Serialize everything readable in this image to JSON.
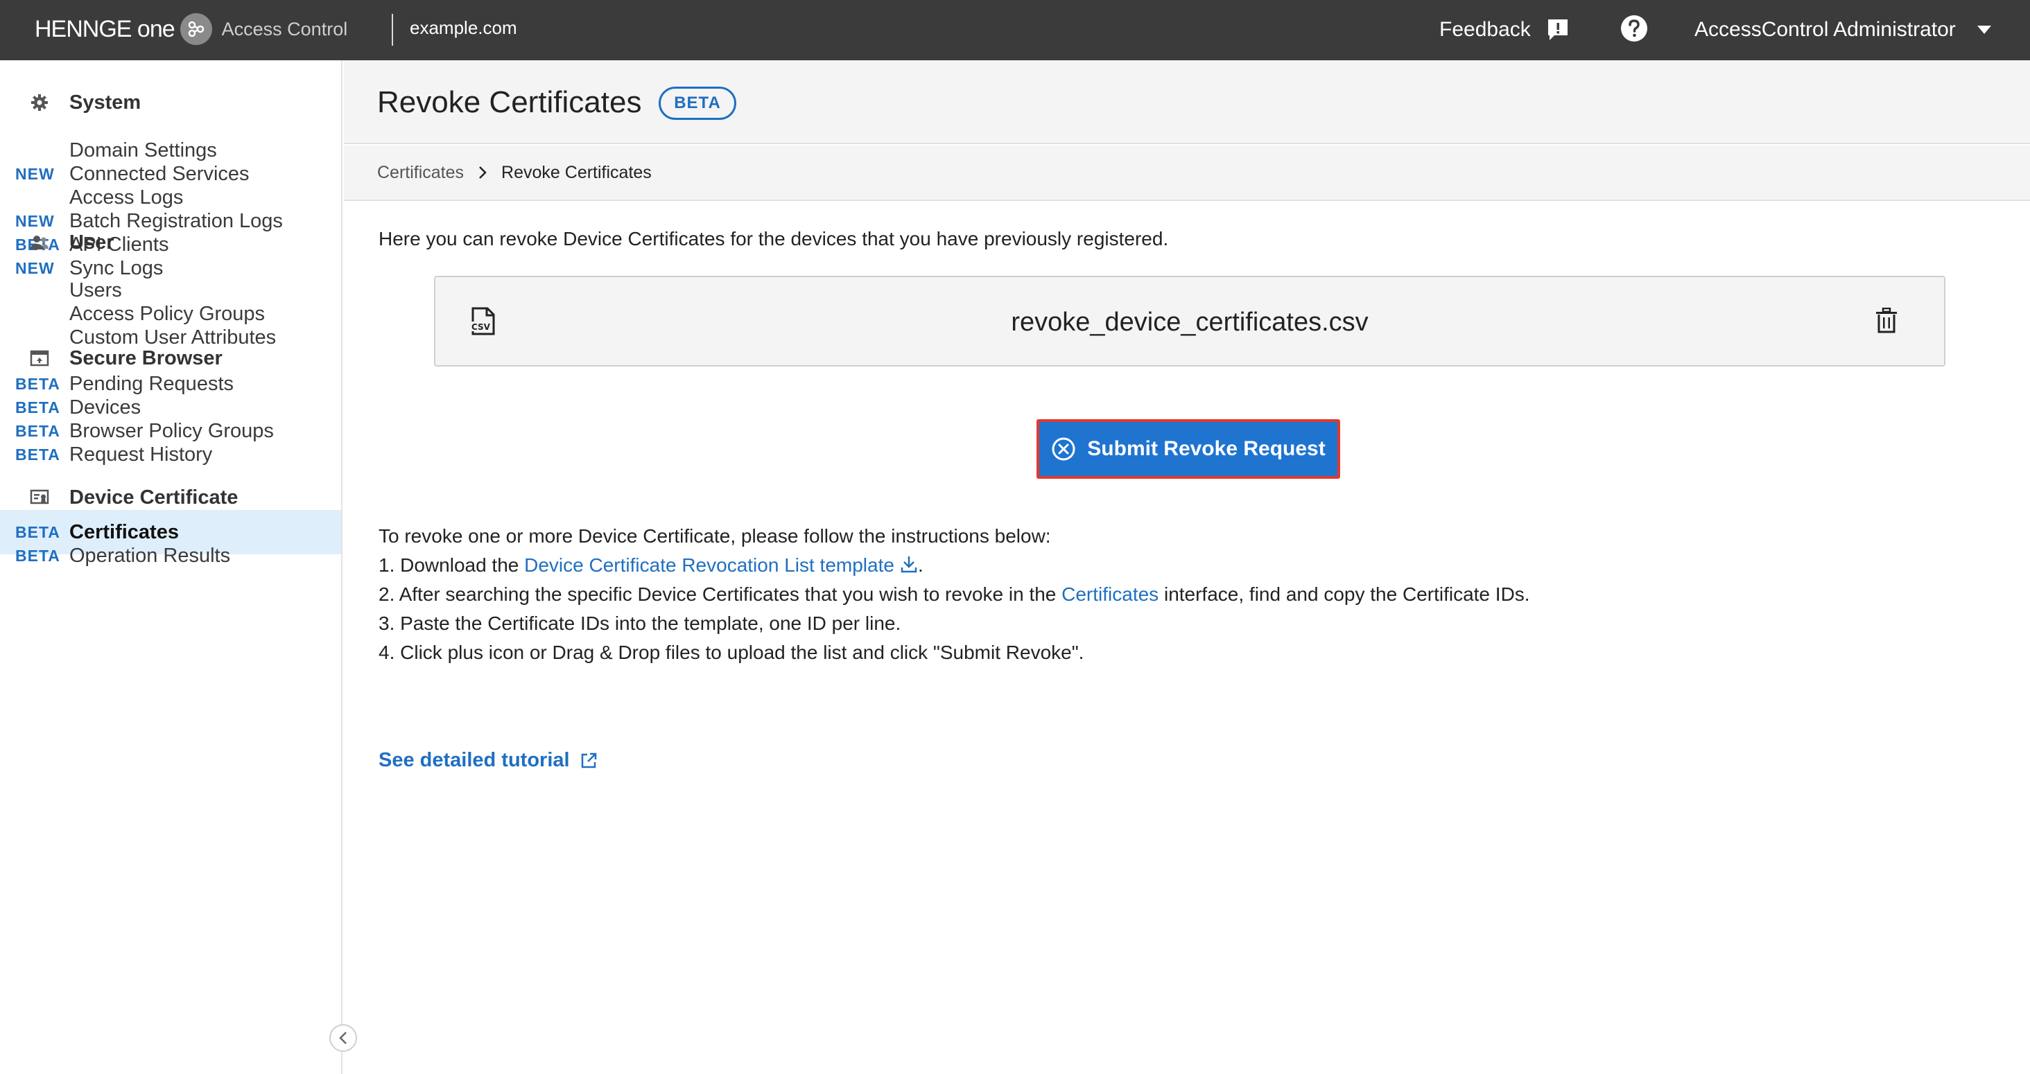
{
  "topbar": {
    "logo_text": "HENNGE one",
    "product": "Access Control",
    "domain": "example.com",
    "feedback_label": "Feedback",
    "user_name": "AccessControl Administrator"
  },
  "sidebar": {
    "sections": [
      {
        "title": "System",
        "icon": "gear-icon",
        "items": [
          {
            "badge": "",
            "label": "Domain Settings"
          },
          {
            "badge": "NEW",
            "label": "Connected Services"
          },
          {
            "badge": "",
            "label": "Access Logs"
          },
          {
            "badge": "NEW",
            "label": "Batch Registration Logs"
          },
          {
            "badge": "BETA",
            "label": "API Clients"
          },
          {
            "badge": "NEW",
            "label": "Sync Logs"
          }
        ]
      },
      {
        "title": "User",
        "icon": "users-icon",
        "items": [
          {
            "badge": "",
            "label": "Users"
          },
          {
            "badge": "",
            "label": "Access Policy Groups"
          },
          {
            "badge": "",
            "label": "Custom User Attributes"
          }
        ]
      },
      {
        "title": "Secure Browser",
        "icon": "browser-icon",
        "items": [
          {
            "badge": "BETA",
            "label": "Pending Requests"
          },
          {
            "badge": "BETA",
            "label": "Devices"
          },
          {
            "badge": "BETA",
            "label": "Browser Policy Groups"
          },
          {
            "badge": "BETA",
            "label": "Request History"
          }
        ]
      },
      {
        "title": "Device Certificate",
        "icon": "certificate-icon",
        "items": [
          {
            "badge": "BETA",
            "label": "Certificates",
            "active": true
          },
          {
            "badge": "BETA",
            "label": "Operation Results"
          }
        ]
      }
    ]
  },
  "page": {
    "title": "Revoke Certificates",
    "title_badge": "BETA",
    "breadcrumb": {
      "parent": "Certificates",
      "current": "Revoke Certificates"
    },
    "intro": "Here you can revoke Device Certificates for the devices that you have previously registered.",
    "file": {
      "name": "revoke_device_certificates.csv",
      "icon": "csv-file-icon"
    },
    "submit_label": "Submit Revoke Request",
    "instructions": {
      "heading": "To revoke one or more Device Certificate, please follow the instructions below:",
      "step1_prefix": "1. Download the ",
      "step1_link": "Device Certificate Revocation List template",
      "step1_suffix": ".",
      "step2_prefix": "2. After searching the specific Device Certificates that you wish to revoke in the ",
      "step2_link": "Certificates",
      "step2_suffix": " interface, find and copy the Certificate IDs.",
      "step3": "3. Paste the Certificate IDs into the template, one ID per line.",
      "step4": "4. Click plus icon or Drag & Drop files to upload the list and click \"Submit Revoke\"."
    },
    "tutorial_label": "See detailed tutorial"
  },
  "colors": {
    "topbar": "#3b3b3b",
    "accent": "#1f6fc1",
    "button": "#1f74d0",
    "button_outline": "#e03a2f",
    "active_item": "#dfeefb"
  }
}
